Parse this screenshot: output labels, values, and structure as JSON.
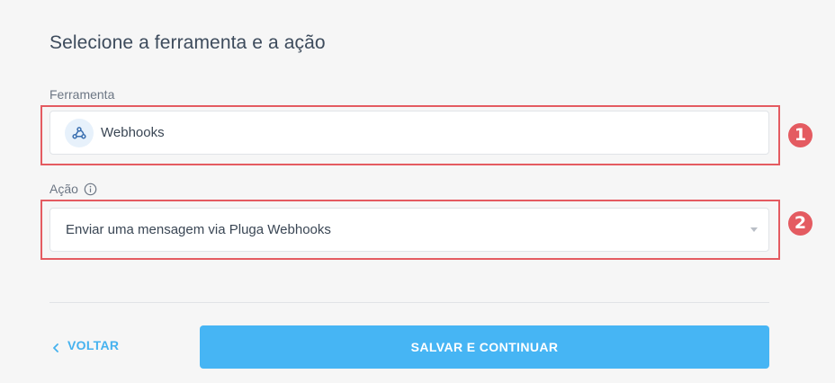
{
  "page_title": "Selecione a ferramenta e a ação",
  "tool_field": {
    "label": "Ferramenta",
    "value": "Webhooks",
    "icon": "webhook-icon"
  },
  "action_field": {
    "label": "Ação",
    "value": "Enviar uma mensagem via Pluga Webhooks",
    "info_icon": "info-icon",
    "dropdown_icon": "caret-down-icon"
  },
  "step_badges": [
    "1",
    "2"
  ],
  "footer": {
    "back_label": "VOLTAR",
    "save_label": "SALVAR E CONTINUAR"
  },
  "colors": {
    "accent": "#46b5f4",
    "highlight": "#e45b61",
    "background": "#f6f6f6"
  }
}
